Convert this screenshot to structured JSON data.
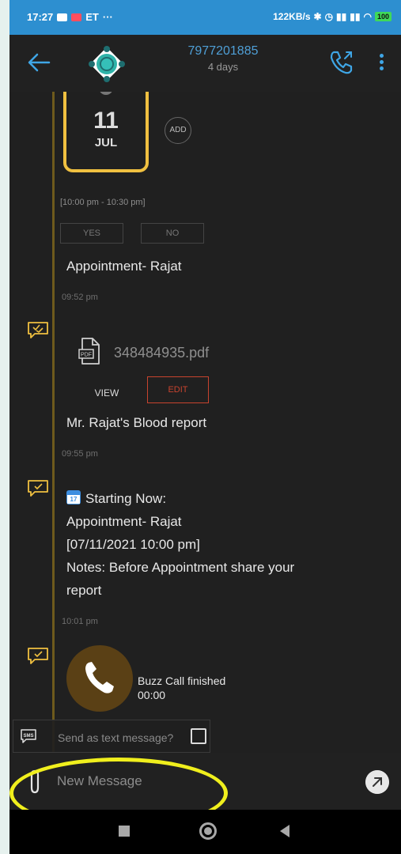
{
  "status_bar": {
    "time": "17:27",
    "carrier": "ET",
    "more": "···",
    "speed": "122KB/s",
    "battery": "100"
  },
  "header": {
    "contact_number": "7977201885",
    "subtitle": "4 days",
    "accent_color": "#4f9fd6"
  },
  "messages": [
    {
      "type": "appointment",
      "calendar_day": "11",
      "calendar_month": "JUL",
      "add_label": "ADD",
      "time_range": "[10:00 pm - 10:30 pm]",
      "yes_label": "YES",
      "no_label": "NO",
      "text": "Appointment- Rajat",
      "timestamp": "09:52 pm"
    },
    {
      "type": "file",
      "file_name": "348484935.pdf",
      "view_label": "VIEW",
      "edit_label": "EDIT",
      "text": "Mr. Rajat's Blood report",
      "timestamp": "09:55 pm"
    },
    {
      "type": "reminder",
      "line1": "Starting Now:",
      "line2": "Appointment- Rajat",
      "line3": "[07/11/2021 10:00 pm]",
      "line4": "Notes: Before Appointment share your",
      "line5": "report",
      "timestamp": "10:01 pm"
    },
    {
      "type": "call",
      "status": "Buzz Call finished",
      "duration": "00:00"
    }
  ],
  "sms_option": {
    "badge": "SMS",
    "label": "Send as text message?"
  },
  "composer": {
    "placeholder": "New Message"
  },
  "icons": [
    "back-arrow-icon",
    "app-logo",
    "call-icon",
    "overflow-menu-icon",
    "checklist-icon",
    "pdf-file-icon",
    "calendar-emoji-icon",
    "phone-icon",
    "sms-icon",
    "paperclip-icon",
    "send-icon"
  ],
  "colors": {
    "status_bar": "#2d8fd0",
    "calendar": "#f0c040",
    "edit": "#c8432e",
    "highlight": "#f0ef1d"
  }
}
